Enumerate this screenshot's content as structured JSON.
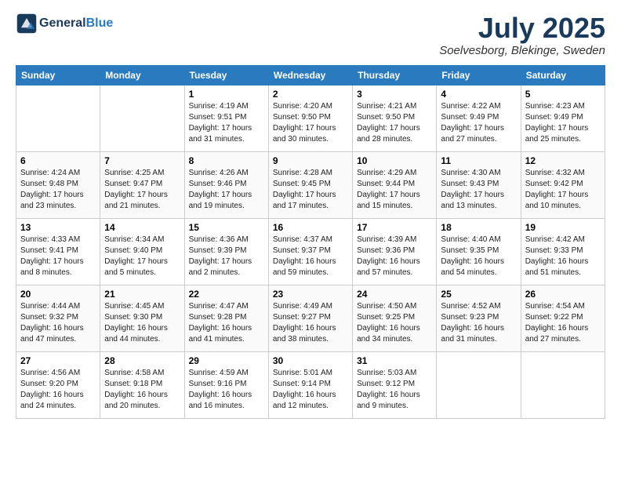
{
  "header": {
    "logo_general": "General",
    "logo_blue": "Blue",
    "title": "July 2025",
    "location": "Soelvesborg, Blekinge, Sweden"
  },
  "days_of_week": [
    "Sunday",
    "Monday",
    "Tuesday",
    "Wednesday",
    "Thursday",
    "Friday",
    "Saturday"
  ],
  "weeks": [
    [
      {
        "day": "",
        "info": ""
      },
      {
        "day": "",
        "info": ""
      },
      {
        "day": "1",
        "info": "Sunrise: 4:19 AM\nSunset: 9:51 PM\nDaylight: 17 hours and 31 minutes."
      },
      {
        "day": "2",
        "info": "Sunrise: 4:20 AM\nSunset: 9:50 PM\nDaylight: 17 hours and 30 minutes."
      },
      {
        "day": "3",
        "info": "Sunrise: 4:21 AM\nSunset: 9:50 PM\nDaylight: 17 hours and 28 minutes."
      },
      {
        "day": "4",
        "info": "Sunrise: 4:22 AM\nSunset: 9:49 PM\nDaylight: 17 hours and 27 minutes."
      },
      {
        "day": "5",
        "info": "Sunrise: 4:23 AM\nSunset: 9:49 PM\nDaylight: 17 hours and 25 minutes."
      }
    ],
    [
      {
        "day": "6",
        "info": "Sunrise: 4:24 AM\nSunset: 9:48 PM\nDaylight: 17 hours and 23 minutes."
      },
      {
        "day": "7",
        "info": "Sunrise: 4:25 AM\nSunset: 9:47 PM\nDaylight: 17 hours and 21 minutes."
      },
      {
        "day": "8",
        "info": "Sunrise: 4:26 AM\nSunset: 9:46 PM\nDaylight: 17 hours and 19 minutes."
      },
      {
        "day": "9",
        "info": "Sunrise: 4:28 AM\nSunset: 9:45 PM\nDaylight: 17 hours and 17 minutes."
      },
      {
        "day": "10",
        "info": "Sunrise: 4:29 AM\nSunset: 9:44 PM\nDaylight: 17 hours and 15 minutes."
      },
      {
        "day": "11",
        "info": "Sunrise: 4:30 AM\nSunset: 9:43 PM\nDaylight: 17 hours and 13 minutes."
      },
      {
        "day": "12",
        "info": "Sunrise: 4:32 AM\nSunset: 9:42 PM\nDaylight: 17 hours and 10 minutes."
      }
    ],
    [
      {
        "day": "13",
        "info": "Sunrise: 4:33 AM\nSunset: 9:41 PM\nDaylight: 17 hours and 8 minutes."
      },
      {
        "day": "14",
        "info": "Sunrise: 4:34 AM\nSunset: 9:40 PM\nDaylight: 17 hours and 5 minutes."
      },
      {
        "day": "15",
        "info": "Sunrise: 4:36 AM\nSunset: 9:39 PM\nDaylight: 17 hours and 2 minutes."
      },
      {
        "day": "16",
        "info": "Sunrise: 4:37 AM\nSunset: 9:37 PM\nDaylight: 16 hours and 59 minutes."
      },
      {
        "day": "17",
        "info": "Sunrise: 4:39 AM\nSunset: 9:36 PM\nDaylight: 16 hours and 57 minutes."
      },
      {
        "day": "18",
        "info": "Sunrise: 4:40 AM\nSunset: 9:35 PM\nDaylight: 16 hours and 54 minutes."
      },
      {
        "day": "19",
        "info": "Sunrise: 4:42 AM\nSunset: 9:33 PM\nDaylight: 16 hours and 51 minutes."
      }
    ],
    [
      {
        "day": "20",
        "info": "Sunrise: 4:44 AM\nSunset: 9:32 PM\nDaylight: 16 hours and 47 minutes."
      },
      {
        "day": "21",
        "info": "Sunrise: 4:45 AM\nSunset: 9:30 PM\nDaylight: 16 hours and 44 minutes."
      },
      {
        "day": "22",
        "info": "Sunrise: 4:47 AM\nSunset: 9:28 PM\nDaylight: 16 hours and 41 minutes."
      },
      {
        "day": "23",
        "info": "Sunrise: 4:49 AM\nSunset: 9:27 PM\nDaylight: 16 hours and 38 minutes."
      },
      {
        "day": "24",
        "info": "Sunrise: 4:50 AM\nSunset: 9:25 PM\nDaylight: 16 hours and 34 minutes."
      },
      {
        "day": "25",
        "info": "Sunrise: 4:52 AM\nSunset: 9:23 PM\nDaylight: 16 hours and 31 minutes."
      },
      {
        "day": "26",
        "info": "Sunrise: 4:54 AM\nSunset: 9:22 PM\nDaylight: 16 hours and 27 minutes."
      }
    ],
    [
      {
        "day": "27",
        "info": "Sunrise: 4:56 AM\nSunset: 9:20 PM\nDaylight: 16 hours and 24 minutes."
      },
      {
        "day": "28",
        "info": "Sunrise: 4:58 AM\nSunset: 9:18 PM\nDaylight: 16 hours and 20 minutes."
      },
      {
        "day": "29",
        "info": "Sunrise: 4:59 AM\nSunset: 9:16 PM\nDaylight: 16 hours and 16 minutes."
      },
      {
        "day": "30",
        "info": "Sunrise: 5:01 AM\nSunset: 9:14 PM\nDaylight: 16 hours and 12 minutes."
      },
      {
        "day": "31",
        "info": "Sunrise: 5:03 AM\nSunset: 9:12 PM\nDaylight: 16 hours and 9 minutes."
      },
      {
        "day": "",
        "info": ""
      },
      {
        "day": "",
        "info": ""
      }
    ]
  ]
}
